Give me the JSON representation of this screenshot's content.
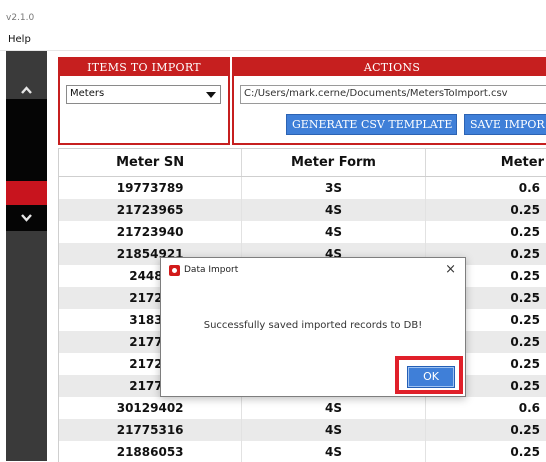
{
  "window": {
    "version": "v2.1.0"
  },
  "menu": {
    "help": "Help"
  },
  "items_panel": {
    "title": "ITEMS TO IMPORT",
    "selected": "Meters"
  },
  "actions_panel": {
    "title": "ACTIONS",
    "path": "C:/Users/mark.cerne/Documents/MetersToImport.csv",
    "generate_label": "GENERATE CSV TEMPLATE",
    "save_label": "SAVE IMPOR"
  },
  "table": {
    "columns": [
      "Meter SN",
      "Meter Form",
      "Meter"
    ],
    "rows": [
      [
        "19773789",
        "3S",
        "0.6"
      ],
      [
        "21723965",
        "4S",
        "0.25"
      ],
      [
        "21723940",
        "4S",
        "0.25"
      ],
      [
        "21854921",
        "4S",
        "0.25"
      ],
      [
        "24480",
        "",
        "0.25"
      ],
      [
        "21724",
        "",
        "0.25"
      ],
      [
        "31832",
        "",
        "0.25"
      ],
      [
        "21775",
        "",
        "0.25"
      ],
      [
        "21724",
        "",
        "0.25"
      ],
      [
        "21775",
        "4S",
        "0.25"
      ],
      [
        "30129402",
        "4S",
        "0.6"
      ],
      [
        "21775316",
        "4S",
        "0.25"
      ],
      [
        "21886053",
        "4S",
        "0.25"
      ]
    ]
  },
  "dialog": {
    "title": "Data Import",
    "close": "×",
    "message": "Successfully saved imported records to DB!",
    "ok_label": "OK"
  },
  "colors": {
    "accent_red": "#c61f1f",
    "button_blue": "#3f7fd8",
    "highlight_red": "#e0202a"
  }
}
